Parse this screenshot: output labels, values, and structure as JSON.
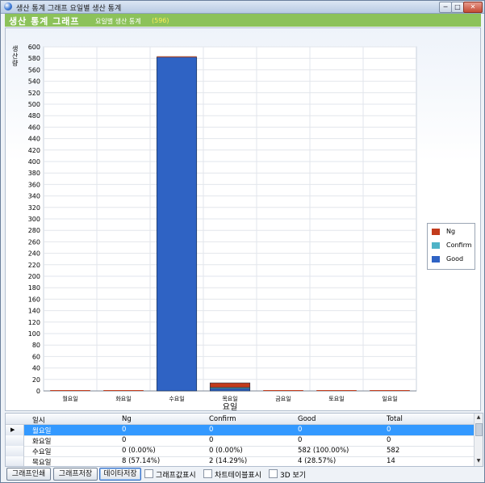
{
  "window": {
    "title": "생산 통계 그래프 요일별 생산 통계",
    "minimize_glyph": "─",
    "maximize_glyph": "□",
    "close_glyph": "✕"
  },
  "header": {
    "title": "생산 통계 그래프",
    "subtitle": "요일별 생산 통계",
    "count": "(596)",
    "background_color": "#8cc25a"
  },
  "chart_data": {
    "type": "bar",
    "stacked": true,
    "categories": [
      "월요일",
      "화요일",
      "수요일",
      "목요일",
      "금요일",
      "토요일",
      "일요일"
    ],
    "series": [
      {
        "name": "Good",
        "color": "#2f63c4",
        "values": [
          0,
          0,
          582,
          4,
          0,
          0,
          0
        ]
      },
      {
        "name": "Confirm",
        "color": "#4fb3c7",
        "values": [
          0,
          0,
          0,
          2,
          0,
          0,
          0
        ]
      },
      {
        "name": "Ng",
        "color": "#c23b1c",
        "values": [
          0,
          0,
          0,
          8,
          0,
          0,
          0
        ]
      }
    ],
    "xlabel": "요일",
    "ylabel": "생산량",
    "ylim": [
      0,
      600
    ],
    "ytick_step": 20,
    "grid": true,
    "legend_position": "right"
  },
  "legend": {
    "items": [
      {
        "label": "Ng",
        "color": "#c23b1c"
      },
      {
        "label": "Confirm",
        "color": "#4fb3c7"
      },
      {
        "label": "Good",
        "color": "#2f63c4"
      }
    ]
  },
  "table": {
    "columns": [
      "일시",
      "Ng",
      "Confirm",
      "Good",
      "Total"
    ],
    "rows": [
      {
        "day": "월요일",
        "ng": "0",
        "confirm": "0",
        "good": "0",
        "total": "0",
        "selected": true
      },
      {
        "day": "화요일",
        "ng": "0",
        "confirm": "0",
        "good": "0",
        "total": "0",
        "selected": false
      },
      {
        "day": "수요일",
        "ng": "0 (0.00%)",
        "confirm": "0 (0.00%)",
        "good": "582 (100.00%)",
        "total": "582",
        "selected": false
      },
      {
        "day": "목요일",
        "ng": "8 (57.14%)",
        "confirm": "2 (14.29%)",
        "good": "4 (28.57%)",
        "total": "14",
        "selected": false
      }
    ],
    "scroll_up_glyph": "▲",
    "scroll_down_glyph": "▼",
    "current_row_glyph": "▶"
  },
  "toolbar": {
    "print_label": "그래프인쇄",
    "save_graph_label": "그래프저장",
    "save_data_label": "데이타저장",
    "show_values_label": "그래프값표시",
    "show_table_label": "차트테이블표시",
    "view_3d_label": "3D 보기"
  }
}
